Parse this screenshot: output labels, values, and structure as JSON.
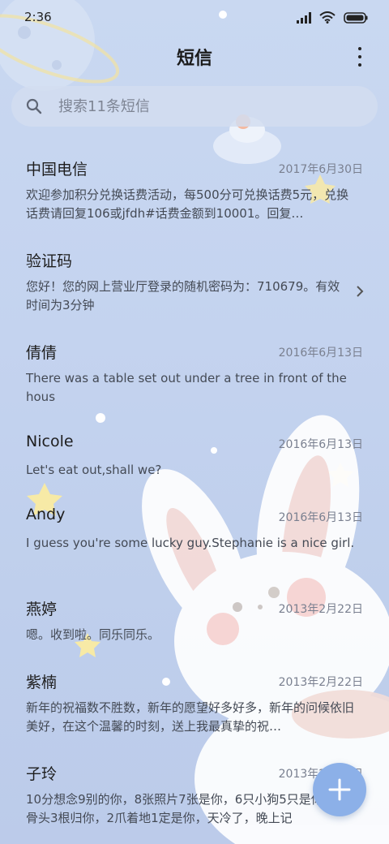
{
  "status_bar": {
    "time": "2:36"
  },
  "header": {
    "title": "短信"
  },
  "search": {
    "placeholder": "搜索11条短信"
  },
  "messages": [
    {
      "sender": "中国电信",
      "date": "2017年6月30日",
      "preview": "欢迎参加积分兑换话费活动，每500分可兑换话费5元，兑换话费请回复106或jfdh#话费金额到10001。回复…"
    },
    {
      "sender": "验证码",
      "date": "",
      "preview": "您好！您的网上营业厅登录的随机密码为：710679。有效时间为3分钟"
    },
    {
      "sender": "倩倩",
      "date": "2016年6月13日",
      "preview": "There was a table set out under a tree in front of the hous"
    },
    {
      "sender": "Nicole",
      "date": "2016年6月13日",
      "preview": "Let's eat out,shall we?"
    },
    {
      "sender": "Andy",
      "date": "2016年6月13日",
      "preview": "I guess you're some lucky guy.Stephanie is a nice girl."
    },
    {
      "sender": "燕婷",
      "date": "2013年2月22日",
      "preview": "嗯。收到啦。同乐同乐。"
    },
    {
      "sender": "紫楠",
      "date": "2013年2月22日",
      "preview": "新年的祝福数不胜数，新年的愿望好多好多，新年的问候依旧美好，在这个温馨的时刻，送上我最真挚的祝…"
    },
    {
      "sender": "子玲",
      "date": "2013年2月22日",
      "preview": "10分想念9别的你，8张照片7张是你，6只小狗5只是你，4根骨头3根归你，2爪着地1定是你，天冷了，晚上记"
    }
  ],
  "icons": {
    "search": "search-icon",
    "more": "more-vertical-icon",
    "chevron": "chevron-right-icon",
    "compose": "plus-icon"
  },
  "colors": {
    "fab": "#8cb0e8",
    "background": "#c6d5f0"
  }
}
